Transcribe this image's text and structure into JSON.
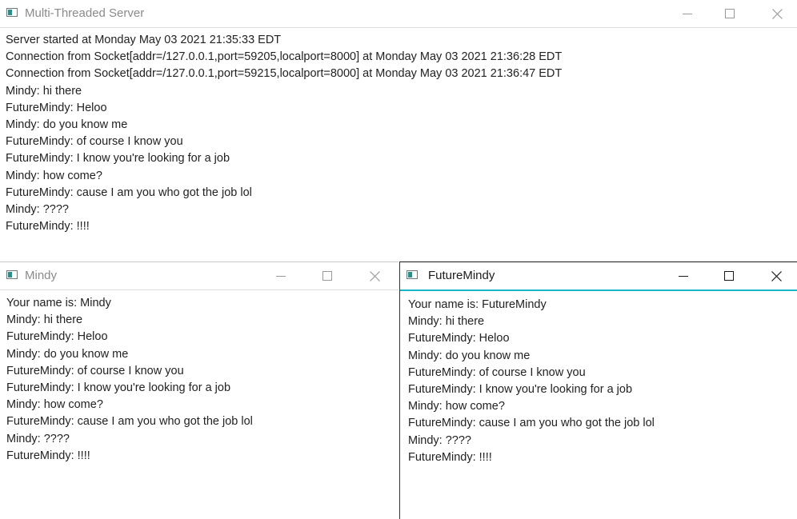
{
  "server": {
    "title": "Multi-Threaded Server",
    "lines": [
      "Server started at Monday May 03 2021 21:35:33 EDT",
      "Connection from Socket[addr=/127.0.0.1,port=59205,localport=8000] at Monday May 03 2021 21:36:28 EDT",
      "Connection from Socket[addr=/127.0.0.1,port=59215,localport=8000] at Monday May 03 2021 21:36:47 EDT",
      "Mindy: hi there",
      "FutureMindy: Heloo",
      "Mindy: do you know me",
      "FutureMindy: of course I know you",
      "FutureMindy: I know you're looking for a job",
      "Mindy: how come?",
      "FutureMindy: cause I am you who got the job lol",
      "Mindy: ????",
      "FutureMindy: !!!!"
    ]
  },
  "mindy": {
    "title": "Mindy",
    "lines": [
      "Your name is: Mindy",
      "Mindy: hi there",
      "FutureMindy: Heloo",
      "Mindy: do you know me",
      "FutureMindy: of course I know you",
      "FutureMindy: I know you're looking for a job",
      "Mindy: how come?",
      "FutureMindy: cause I am you who got the job lol",
      "Mindy: ????",
      "FutureMindy: !!!!"
    ]
  },
  "future": {
    "title": "FutureMindy",
    "lines": [
      "Your name is: FutureMindy",
      "Mindy: hi there",
      "FutureMindy: Heloo",
      "Mindy: do you know me",
      "FutureMindy: of course I know you",
      "FutureMindy: I know you're looking for a job",
      "Mindy: how come?",
      "FutureMindy: cause I am you who got the job lol",
      "Mindy: ????",
      "FutureMindy: !!!!"
    ]
  },
  "colors": {
    "focus_border": "#19b6c9",
    "icon_accent": "#2f8c86"
  }
}
